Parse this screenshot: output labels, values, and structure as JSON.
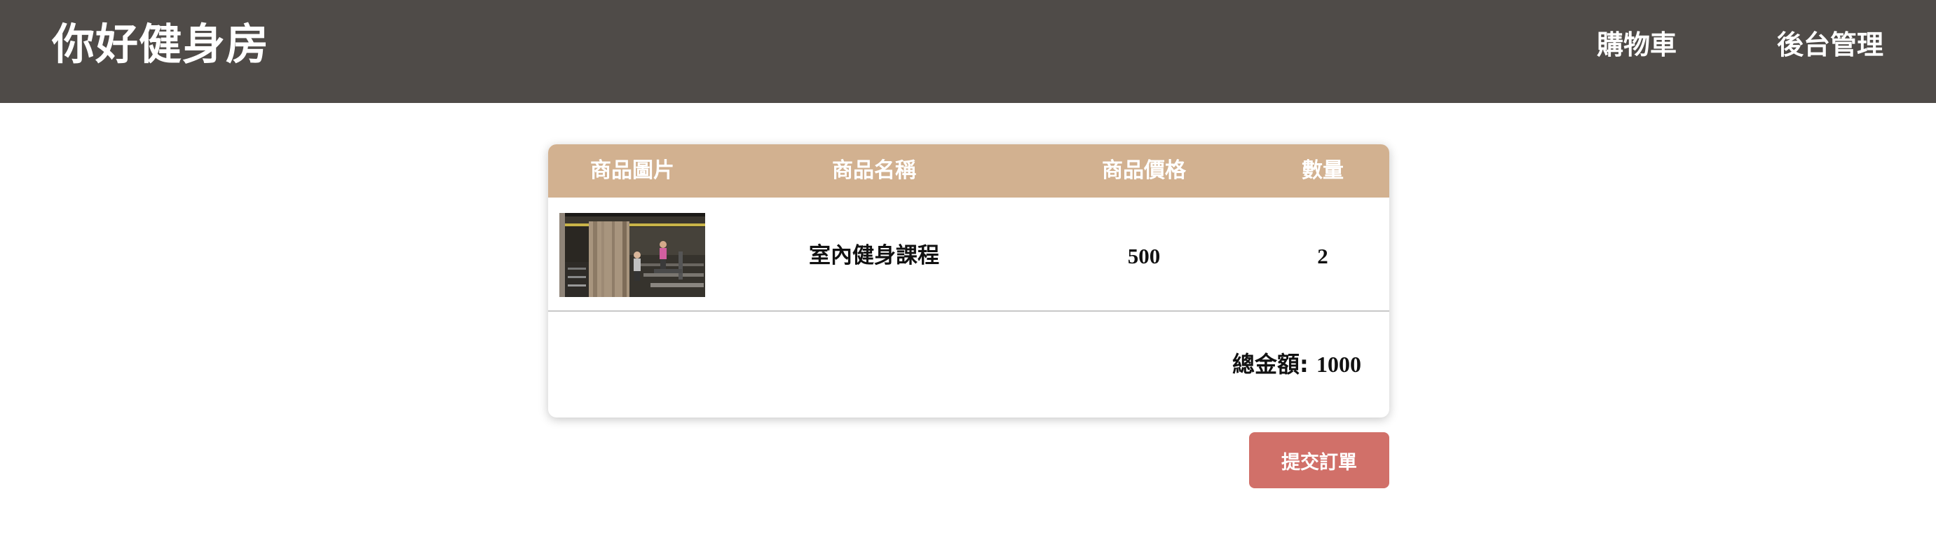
{
  "header": {
    "brand": "你好健身房",
    "nav": {
      "cart": "購物車",
      "admin": "後台管理"
    }
  },
  "cart": {
    "columns": [
      "商品圖片",
      "商品名稱",
      "商品價格",
      "數量"
    ],
    "items": [
      {
        "image": "gym-interior-photo",
        "name": "室內健身課程",
        "price": "500",
        "quantity": "2"
      }
    ],
    "total_label": "總金額: ",
    "total_value": "1000"
  },
  "actions": {
    "submit_label": "提交訂單"
  },
  "colors": {
    "header_bg": "#4f4b48",
    "table_header_bg": "#d2b190",
    "submit_bg": "#d17069"
  }
}
